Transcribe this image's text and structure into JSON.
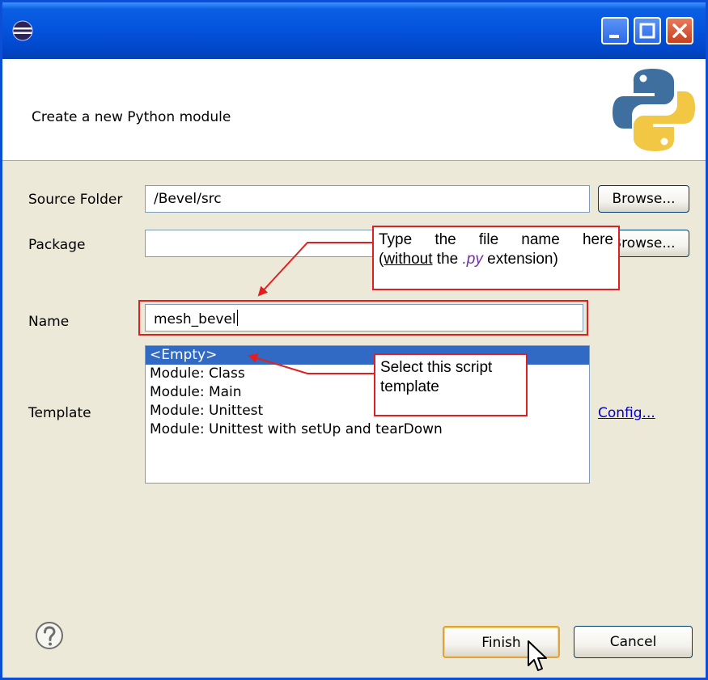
{
  "header": {
    "description": "Create a new Python module"
  },
  "form": {
    "source_folder_label": "Source Folder",
    "source_folder_value": "/Bevel/src",
    "browse_label": "Browse...",
    "package_label": "Package",
    "package_value": "",
    "package_browse_label": "Browse...",
    "name_label": "Name",
    "name_value": "mesh_bevel",
    "template_label": "Template",
    "config_link": "Config..."
  },
  "templates": [
    "<Empty>",
    "Module: Class",
    "Module: Main",
    "Module: Unittest",
    "Module: Unittest with setUp and tearDown"
  ],
  "selected_template_index": 0,
  "buttons": {
    "finish": "Finish",
    "cancel": "Cancel"
  },
  "annotations": {
    "name_callout_line1": "Type the file name here",
    "name_callout_line2_a": "(",
    "name_callout_line2_b": "without",
    "name_callout_line2_c": " the ",
    "name_callout_line2_d": ".py",
    "name_callout_line2_e": " extension)",
    "template_callout": "Select this script template"
  },
  "icons": {
    "app": "eclipse-icon",
    "logo": "python-logo",
    "help": "help-icon",
    "cursor": "mouse-cursor-icon"
  },
  "colors": {
    "titlebar": "#0453dc",
    "selection": "#316ac5",
    "annotation": "#e02020",
    "link": "#0000cc"
  }
}
